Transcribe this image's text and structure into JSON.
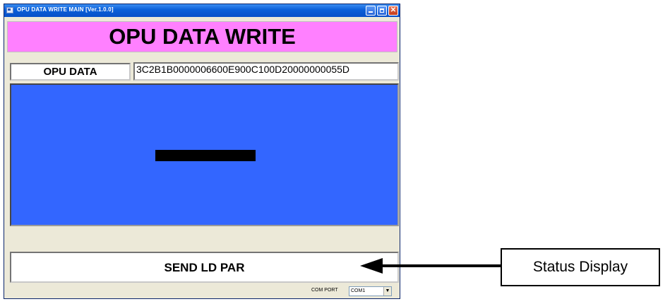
{
  "window": {
    "title": "OPU DATA WRITE MAIN [Ver.1.0.0]"
  },
  "header": {
    "title": "OPU DATA WRITE"
  },
  "opu": {
    "label": "OPU DATA",
    "value": "3C2B1B0000006600E900C100D20000000055D"
  },
  "status": {
    "text": "SEND LD PAR"
  },
  "com_port": {
    "label": "COM PORT",
    "selected": "COM1"
  },
  "annotation": {
    "label": "Status Display"
  },
  "colors": {
    "header_band": "#ff80ff",
    "panel_blue": "#3366ff",
    "titlebar": "#0a5fd8"
  }
}
